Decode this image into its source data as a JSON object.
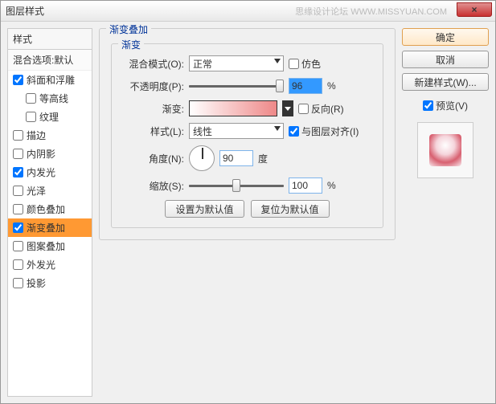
{
  "title": "图层样式",
  "watermark": "思缘设计论坛  WWW.MISSYUAN.COM",
  "close_glyph": "×",
  "left": {
    "header": "样式",
    "sub": "混合选项:默认",
    "items": [
      {
        "label": "斜面和浮雕",
        "checked": true,
        "indent": false
      },
      {
        "label": "等高线",
        "checked": false,
        "indent": true
      },
      {
        "label": "纹理",
        "checked": false,
        "indent": true
      },
      {
        "label": "描边",
        "checked": false,
        "indent": false
      },
      {
        "label": "内阴影",
        "checked": false,
        "indent": false
      },
      {
        "label": "内发光",
        "checked": true,
        "indent": false
      },
      {
        "label": "光泽",
        "checked": false,
        "indent": false
      },
      {
        "label": "颜色叠加",
        "checked": false,
        "indent": false
      },
      {
        "label": "渐变叠加",
        "checked": true,
        "indent": false,
        "selected": true
      },
      {
        "label": "图案叠加",
        "checked": false,
        "indent": false
      },
      {
        "label": "外发光",
        "checked": false,
        "indent": false
      },
      {
        "label": "投影",
        "checked": false,
        "indent": false
      }
    ]
  },
  "center": {
    "legend": "渐变叠加",
    "inner_legend": "渐变",
    "blend_label": "混合模式(O):",
    "blend_value": "正常",
    "dither_label": "仿色",
    "opacity_label": "不透明度(P):",
    "opacity_value": "96",
    "percent": "%",
    "gradient_label": "渐变:",
    "reverse_label": "反向(R)",
    "style_label": "样式(L):",
    "style_value": "线性",
    "align_label": "与图层对齐(I)",
    "angle_label": "角度(N):",
    "angle_value": "90",
    "degree": "度",
    "scale_label": "缩放(S):",
    "scale_value": "100",
    "reset_btn": "设置为默认值",
    "restore_btn": "复位为默认值"
  },
  "right": {
    "ok": "确定",
    "cancel": "取消",
    "new_style": "新建样式(W)...",
    "preview_label": "预览(V)"
  }
}
